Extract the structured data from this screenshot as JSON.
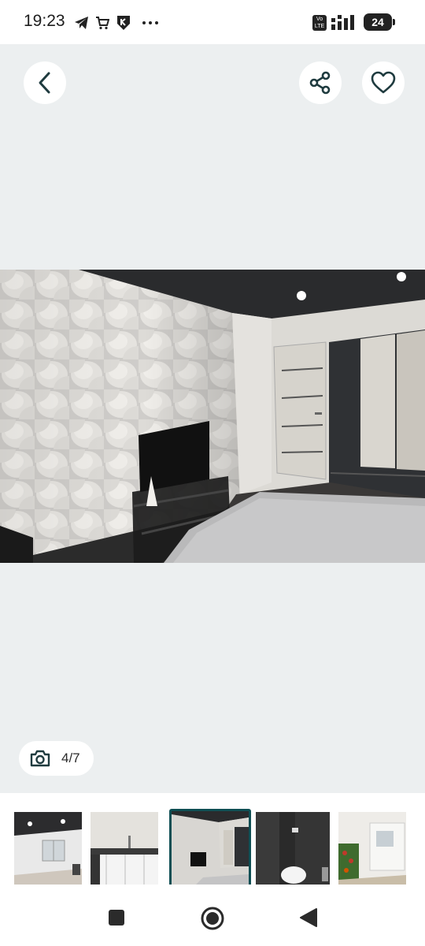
{
  "status_bar": {
    "time": "19:23",
    "volte_label": "Vo LTE",
    "battery_level": "24"
  },
  "header": {
    "back_icon": "chevron-left-icon",
    "share_icon": "share-icon",
    "favorite_icon": "heart-outline-icon"
  },
  "gallery": {
    "counter_text": "4/7",
    "counter_icon": "camera-icon",
    "current_index": 4,
    "total": 7,
    "selected_thumbnail": 3
  },
  "colors": {
    "accent": "#0e4f54",
    "background": "#eceff0"
  },
  "navigation": {
    "recents_icon": "square-icon",
    "home_icon": "circle-icon",
    "back_icon": "triangle-back-icon"
  }
}
